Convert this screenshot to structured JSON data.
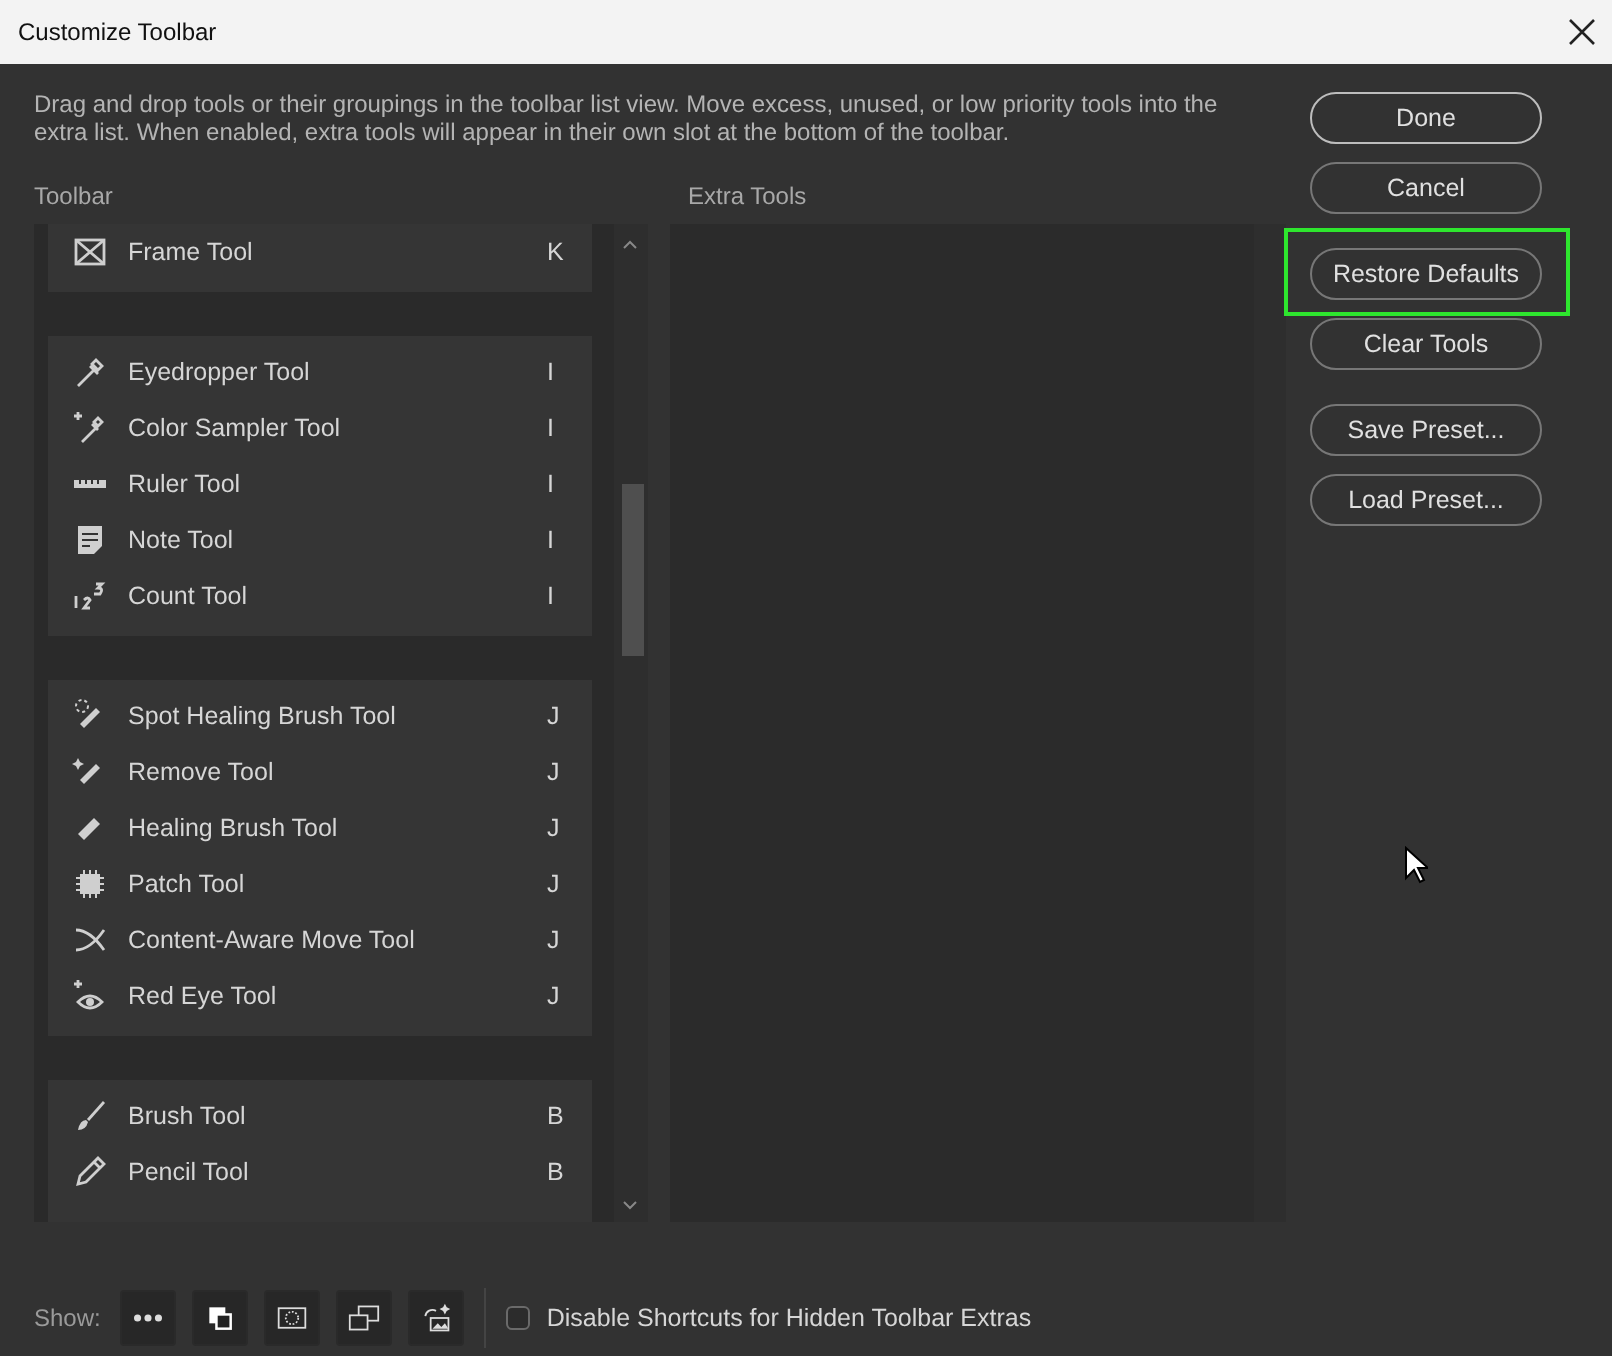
{
  "window": {
    "title": "Customize Toolbar"
  },
  "description": "Drag and drop tools or their groupings in the toolbar list view. Move excess, unused, or low priority tools into the extra list. When enabled, extra tools will appear in their own slot at the bottom of the toolbar.",
  "toolbar": {
    "label": "Toolbar",
    "groups": [
      {
        "tools": [
          {
            "name": "Frame Tool",
            "shortcut": "K"
          }
        ]
      },
      {
        "tools": [
          {
            "name": "Eyedropper Tool",
            "shortcut": "I"
          },
          {
            "name": "Color Sampler Tool",
            "shortcut": "I"
          },
          {
            "name": "Ruler Tool",
            "shortcut": "I"
          },
          {
            "name": "Note Tool",
            "shortcut": "I"
          },
          {
            "name": "Count Tool",
            "shortcut": "I"
          }
        ]
      },
      {
        "tools": [
          {
            "name": "Spot Healing Brush Tool",
            "shortcut": "J"
          },
          {
            "name": "Remove Tool",
            "shortcut": "J"
          },
          {
            "name": "Healing Brush Tool",
            "shortcut": "J"
          },
          {
            "name": "Patch Tool",
            "shortcut": "J"
          },
          {
            "name": "Content-Aware Move Tool",
            "shortcut": "J"
          },
          {
            "name": "Red Eye Tool",
            "shortcut": "J"
          }
        ]
      },
      {
        "tools": [
          {
            "name": "Brush Tool",
            "shortcut": "B"
          },
          {
            "name": "Pencil Tool",
            "shortcut": "B"
          }
        ]
      }
    ]
  },
  "extra_tools": {
    "label": "Extra Tools"
  },
  "button_groups": [
    [
      {
        "label": "Done",
        "default": true,
        "highlighted": false
      },
      {
        "label": "Cancel",
        "default": false,
        "highlighted": false
      }
    ],
    [
      {
        "label": "Restore Defaults",
        "default": false,
        "highlighted": true
      },
      {
        "label": "Clear Tools",
        "default": false,
        "highlighted": false
      }
    ],
    [
      {
        "label": "Save Preset...",
        "default": false,
        "highlighted": false
      },
      {
        "label": "Load Preset...",
        "default": false,
        "highlighted": false
      }
    ]
  ],
  "show": {
    "label": "Show:"
  },
  "disable_shortcuts": {
    "label": "Disable Shortcuts for Hidden Toolbar Extras",
    "checked": false
  }
}
